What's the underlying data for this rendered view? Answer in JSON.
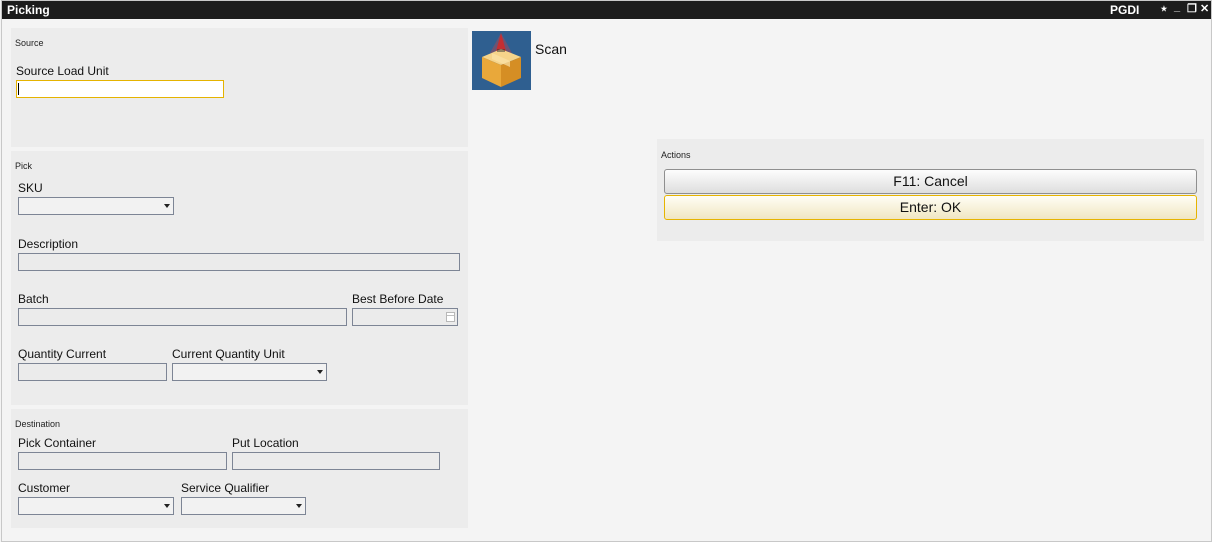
{
  "window": {
    "title": "Picking",
    "user": "PGDI",
    "controls": {
      "pin": "⭑",
      "minimize": "_",
      "restore": "❐",
      "close": "✕"
    }
  },
  "source": {
    "title": "Source",
    "load_unit_label": "Source Load Unit",
    "load_unit_value": ""
  },
  "scan": {
    "label": "Scan",
    "icon": "scan-box-icon"
  },
  "pick": {
    "title": "Pick",
    "sku_label": "SKU",
    "sku_value": "",
    "description_label": "Description",
    "description_value": "",
    "batch_label": "Batch",
    "batch_value": "",
    "best_before_label": "Best Before Date",
    "best_before_value": "",
    "qty_current_label": "Quantity Current",
    "qty_current_value": "",
    "qty_unit_label": "Current Quantity Unit",
    "qty_unit_value": ""
  },
  "destination": {
    "title": "Destination",
    "pick_container_label": "Pick Container",
    "pick_container_value": "",
    "put_location_label": "Put Location",
    "put_location_value": "",
    "customer_label": "Customer",
    "customer_value": "",
    "service_qualifier_label": "Service Qualifier",
    "service_qualifier_value": ""
  },
  "actions": {
    "title": "Actions",
    "cancel_label": "F11: Cancel",
    "ok_label": "Enter: OK"
  },
  "colors": {
    "titlebar": "#1c1c1c",
    "focus": "#e5b300",
    "panel": "#ececec"
  }
}
